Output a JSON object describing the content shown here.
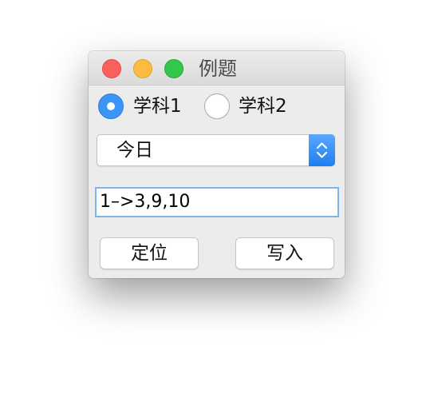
{
  "window": {
    "title": "例题"
  },
  "radios": [
    {
      "label": "学科1",
      "selected": true
    },
    {
      "label": "学科2",
      "selected": false
    }
  ],
  "select": {
    "value": "今日"
  },
  "text_field": {
    "value": "1–>3,9,10"
  },
  "buttons": {
    "locate_label": "定位",
    "write_label": "写入"
  },
  "colors": {
    "close": "#fc605c",
    "minimize": "#fdbc40",
    "maximize": "#34c84a",
    "accent": "#3b95f5"
  },
  "icons": {
    "select_arrows": "chevron-up-down-icon"
  }
}
